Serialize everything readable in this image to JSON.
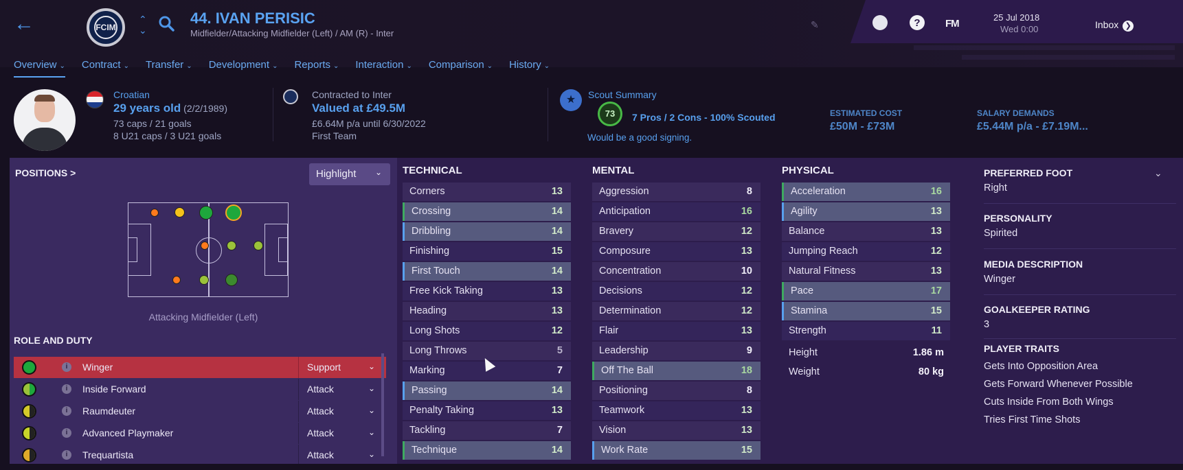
{
  "header": {
    "player_name": "44. IVAN PERISIC",
    "player_subtitle": "Midfielder/Attacking Midfielder (Left) / AM (R) - Inter",
    "club_crest_text": "FCIM",
    "date": "25 Jul 2018",
    "time": "Wed 0:00",
    "inbox_label": "Inbox",
    "fm_label": "FM",
    "help_label": "?"
  },
  "tabs": [
    {
      "label": "Overview"
    },
    {
      "label": "Contract"
    },
    {
      "label": "Transfer"
    },
    {
      "label": "Development"
    },
    {
      "label": "Reports"
    },
    {
      "label": "Interaction"
    },
    {
      "label": "Comparison"
    },
    {
      "label": "History"
    }
  ],
  "profile": {
    "nationality": "Croatian",
    "age": "29 years old",
    "dob": "(2/2/1989)",
    "caps": "73 caps / 21 goals",
    "u21_caps": "8 U21 caps / 3 U21 goals"
  },
  "contract": {
    "label": "Contracted to Inter",
    "value": "Valued at £49.5M",
    "wage": "£6.64M p/a until 6/30/2022",
    "squad": "First Team"
  },
  "scout": {
    "title": "Scout Summary",
    "rating": "73",
    "summary": "7 Pros / 2 Cons - 100% Scouted",
    "verdict": "Would be a good signing.",
    "est_cost_label": "ESTIMATED COST",
    "est_cost_value": "£50M - £73M",
    "salary_label": "SALARY DEMANDS",
    "salary_value": "£5.44M p/a - £7.19M..."
  },
  "positions": {
    "title": "POSITIONS",
    "arrow": ">",
    "highlight_label": "Highlight",
    "caption": "Attacking Midfielder (Left)"
  },
  "roles": {
    "title": "ROLE AND DUTY",
    "items": [
      {
        "name": "Winger",
        "duty": "Support"
      },
      {
        "name": "Inside Forward",
        "duty": "Attack"
      },
      {
        "name": "Raumdeuter",
        "duty": "Attack"
      },
      {
        "name": "Advanced Playmaker",
        "duty": "Attack"
      },
      {
        "name": "Trequartista",
        "duty": "Attack"
      }
    ]
  },
  "technical": {
    "title": "TECHNICAL",
    "items": [
      {
        "name": "Corners",
        "value": "13"
      },
      {
        "name": "Crossing",
        "value": "14"
      },
      {
        "name": "Dribbling",
        "value": "14"
      },
      {
        "name": "Finishing",
        "value": "15"
      },
      {
        "name": "First Touch",
        "value": "14"
      },
      {
        "name": "Free Kick Taking",
        "value": "13"
      },
      {
        "name": "Heading",
        "value": "13"
      },
      {
        "name": "Long Shots",
        "value": "12"
      },
      {
        "name": "Long Throws",
        "value": "5"
      },
      {
        "name": "Marking",
        "value": "7"
      },
      {
        "name": "Passing",
        "value": "14"
      },
      {
        "name": "Penalty Taking",
        "value": "13"
      },
      {
        "name": "Tackling",
        "value": "7"
      },
      {
        "name": "Technique",
        "value": "14"
      }
    ]
  },
  "mental": {
    "title": "MENTAL",
    "items": [
      {
        "name": "Aggression",
        "value": "8"
      },
      {
        "name": "Anticipation",
        "value": "16"
      },
      {
        "name": "Bravery",
        "value": "12"
      },
      {
        "name": "Composure",
        "value": "13"
      },
      {
        "name": "Concentration",
        "value": "10"
      },
      {
        "name": "Decisions",
        "value": "12"
      },
      {
        "name": "Determination",
        "value": "12"
      },
      {
        "name": "Flair",
        "value": "13"
      },
      {
        "name": "Leadership",
        "value": "9"
      },
      {
        "name": "Off The Ball",
        "value": "18"
      },
      {
        "name": "Positioning",
        "value": "8"
      },
      {
        "name": "Teamwork",
        "value": "13"
      },
      {
        "name": "Vision",
        "value": "13"
      },
      {
        "name": "Work Rate",
        "value": "15"
      }
    ]
  },
  "physical": {
    "title": "PHYSICAL",
    "items": [
      {
        "name": "Acceleration",
        "value": "16"
      },
      {
        "name": "Agility",
        "value": "13"
      },
      {
        "name": "Balance",
        "value": "13"
      },
      {
        "name": "Jumping Reach",
        "value": "12"
      },
      {
        "name": "Natural Fitness",
        "value": "13"
      },
      {
        "name": "Pace",
        "value": "17"
      },
      {
        "name": "Stamina",
        "value": "15"
      },
      {
        "name": "Strength",
        "value": "11"
      }
    ],
    "height_label": "Height",
    "height_value": "1.86 m",
    "weight_label": "Weight",
    "weight_value": "80 kg"
  },
  "details": {
    "foot_label": "PREFERRED FOOT",
    "foot_value": "Right",
    "personality_label": "PERSONALITY",
    "personality_value": "Spirited",
    "media_label": "MEDIA DESCRIPTION",
    "media_value": "Winger",
    "gk_label": "GOALKEEPER RATING",
    "gk_value": "3",
    "traits_label": "PLAYER TRAITS",
    "traits": [
      "Gets Into Opposition Area",
      "Gets Forward Whenever Possible",
      "Cuts Inside From Both Wings",
      "Tries First Time Shots"
    ]
  },
  "colors": {
    "accent": "#58a0ee",
    "panel": "#2d1d4c",
    "selected_role": "#b63241"
  }
}
